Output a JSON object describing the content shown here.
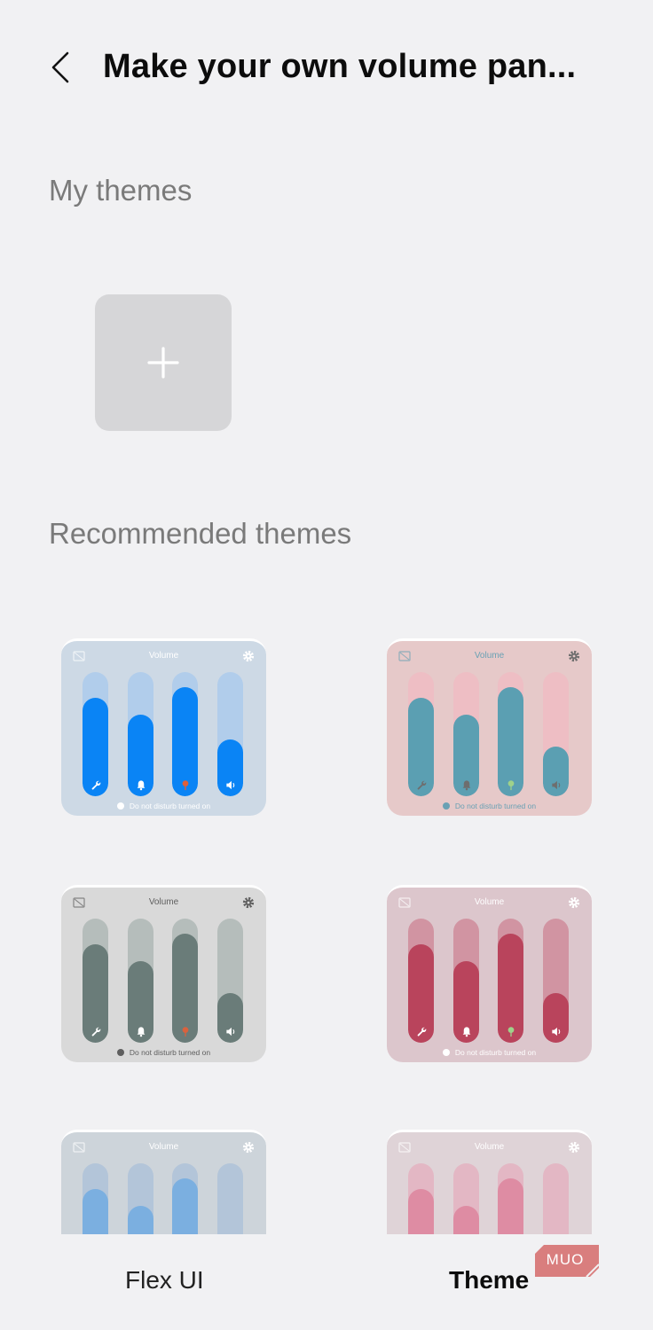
{
  "header": {
    "title": "Make your own volume pan..."
  },
  "sections": {
    "my_themes": "My themes",
    "recommended": "Recommended themes"
  },
  "card_text": {
    "volume": "Volume",
    "dnd": "Do not disturb turned on"
  },
  "nav": {
    "flex_ui": "Flex UI",
    "theme": "Theme",
    "active": "Theme"
  },
  "watermark": {
    "text": "MUO"
  },
  "theme_cards": [
    {
      "bg": "#cdd9e5",
      "track": "#b1cdeb",
      "fill": "#0a84f5",
      "title_color": "#ffffff",
      "text_color": "#ffffff",
      "icon_color": "#ffffff",
      "levels": [
        0.79,
        0.66,
        0.88,
        0.46
      ],
      "show_dnd": true
    },
    {
      "bg": "#e6c9c9",
      "track": "#eebec4",
      "fill": "#5b9fb2",
      "title_color": "#6aa1b4",
      "text_color": "#6aa1b4",
      "icon_color": "#6e6e6e",
      "levels": [
        0.79,
        0.66,
        0.88,
        0.4
      ],
      "show_dnd": true
    },
    {
      "bg": "#d9d9d9",
      "track": "#b5bdbb",
      "fill": "#6a7c79",
      "title_color": "#5f5f5f",
      "text_color": "#5f5f5f",
      "icon_color": "#ffffff",
      "levels": [
        0.79,
        0.66,
        0.88,
        0.4
      ],
      "show_dnd": true
    },
    {
      "bg": "#dcc6cc",
      "track": "#d194a2",
      "fill": "#b9445c",
      "title_color": "#ffffff",
      "text_color": "#ffffff",
      "icon_color": "#ffffff",
      "levels": [
        0.79,
        0.66,
        0.88,
        0.4
      ],
      "show_dnd": true
    },
    {
      "bg": "#cdd4da",
      "track": "#b3c5d9",
      "fill": "#7bafe0",
      "title_color": "#ffffff",
      "text_color": "#ffffff",
      "icon_color": "#ffffff",
      "levels": [
        0.79,
        0.66,
        0.88,
        0.0
      ],
      "show_dnd": false
    },
    {
      "bg": "#dfd3d7",
      "track": "#e3b7c4",
      "fill": "#de8ca3",
      "title_color": "#ffffff",
      "text_color": "#ffffff",
      "icon_color": "#ffffff",
      "levels": [
        0.79,
        0.66,
        0.88,
        0.0
      ],
      "show_dnd": false
    }
  ],
  "slider_icons": [
    "wrench-icon",
    "bell-icon",
    "flower-icon",
    "speaker-icon"
  ]
}
